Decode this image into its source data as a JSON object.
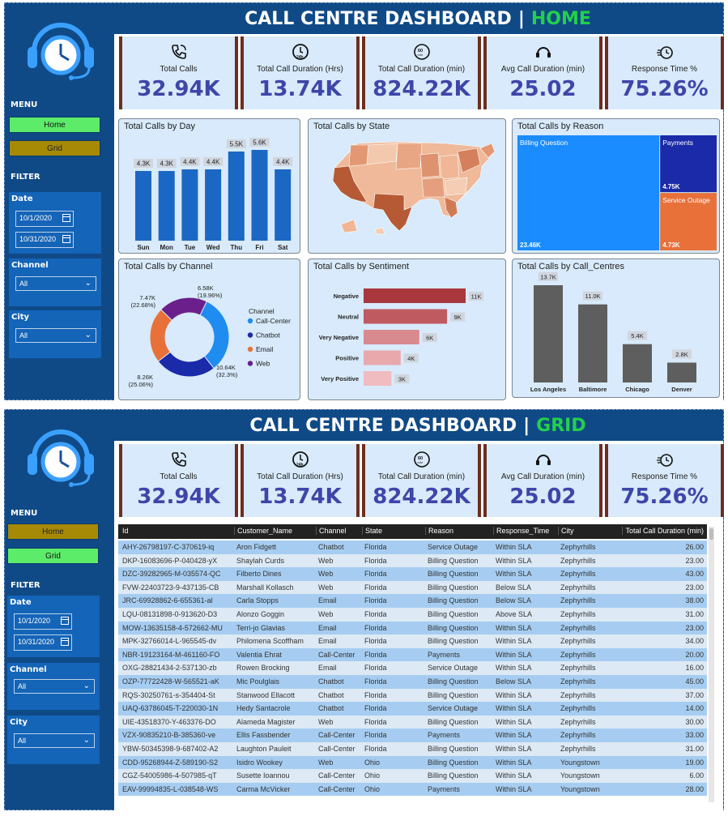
{
  "home": {
    "title": "CALL CENTRE DASHBOARD",
    "separator": "|",
    "section": "HOME",
    "menu_label": "MENU",
    "nav": {
      "home": "Home",
      "grid": "Grid"
    },
    "filter_label": "FILTER",
    "date_label": "Date",
    "date_from": "10/1/2020",
    "date_to": "10/31/2020",
    "channel_label": "Channel",
    "channel_value": "All",
    "city_label": "City",
    "city_value": "All"
  },
  "grid_page": {
    "title": "CALL CENTRE DASHBOARD",
    "separator": "|",
    "section": "GRID",
    "menu_label": "MENU",
    "nav": {
      "home": "Home",
      "grid": "Grid"
    },
    "filter_label": "FILTER",
    "date_label": "Date",
    "date_from": "10/1/2020",
    "date_to": "10/31/2020",
    "channel_label": "Channel",
    "channel_value": "All",
    "city_label": "City",
    "city_value": "All"
  },
  "kpis": [
    {
      "label": "Total Calls",
      "value": "32.94K",
      "icon": "phone-icon"
    },
    {
      "label": "Total Call Duration (Hrs)",
      "value": "13.74K",
      "icon": "24h-clock-icon"
    },
    {
      "label": "Total Call Duration (min)",
      "value": "824.22K",
      "icon": "60min-timer-icon"
    },
    {
      "label": "Avg Call Duration (min)",
      "value": "25.02",
      "icon": "headset-icon"
    },
    {
      "label": "Response Time %",
      "value": "75.26%",
      "icon": "speed-clock-icon"
    }
  ],
  "colors": {
    "header_bg": "#0f4a87",
    "accent_green": "#22d14a",
    "kpi_value": "#3d46a8",
    "bar_blue": "#1b68c4"
  },
  "chart_data": [
    {
      "type": "bar",
      "title": "Total Calls by Day",
      "categories": [
        "Sun",
        "Mon",
        "Tue",
        "Wed",
        "Thu",
        "Fri",
        "Sat"
      ],
      "values": [
        4.3,
        4.3,
        4.4,
        4.4,
        5.5,
        5.6,
        4.4
      ],
      "labels": [
        "4.3K",
        "4.3K",
        "4.4K",
        "4.4K",
        "5.5K",
        "5.6K",
        "4.4K"
      ],
      "unit": "K"
    },
    {
      "type": "map",
      "title": "Total Calls by State"
    },
    {
      "type": "treemap",
      "title": "Total Calls by Reason",
      "items": [
        {
          "name": "Billing Question",
          "value": 23.46,
          "label": "23.46K",
          "color": "#1a8cff"
        },
        {
          "name": "Payments",
          "value": 4.75,
          "label": "4.75K",
          "color": "#1a2aa8"
        },
        {
          "name": "Service Outage",
          "value": 4.73,
          "label": "4.73K",
          "color": "#e8713a"
        }
      ]
    },
    {
      "type": "pie",
      "title": "Total Calls by Channel",
      "legend_title": "Channel",
      "series": [
        {
          "name": "Call-Center",
          "value": 10.64,
          "label": "10.64K",
          "pct": "(32.3%)",
          "color": "#1f8cf0"
        },
        {
          "name": "Chatbot",
          "value": 8.26,
          "label": "8.26K",
          "pct": "(25.06%)",
          "color": "#1a2aa8"
        },
        {
          "name": "Email",
          "value": 7.47,
          "label": "7.47K",
          "pct": "(22.68%)",
          "color": "#e8713a"
        },
        {
          "name": "Web",
          "value": 6.58,
          "label": "6.58K",
          "pct": "(19.96%)",
          "color": "#6a1f8a"
        }
      ]
    },
    {
      "type": "bar",
      "orientation": "horizontal",
      "title": "Total Calls by Sentiment",
      "categories": [
        "Negative",
        "Neutral",
        "Very Negative",
        "Positive",
        "Very Positive"
      ],
      "values": [
        11,
        9,
        6,
        4,
        3
      ],
      "labels": [
        "11K",
        "9K",
        "6K",
        "4K",
        "3K"
      ],
      "colors": [
        "#a8373e",
        "#bf5a60",
        "#d98a8f",
        "#e8a8ac",
        "#f0bcc0"
      ]
    },
    {
      "type": "bar",
      "title": "Total Calls by Call_Centres",
      "categories": [
        "Los Angeles",
        "Baltimore",
        "Chicago",
        "Denver"
      ],
      "values": [
        13.7,
        11.0,
        5.4,
        2.8
      ],
      "labels": [
        "13.7K",
        "11.0K",
        "5.4K",
        "2.8K"
      ],
      "color": "#5e5e5e"
    }
  ],
  "grid": {
    "columns": [
      "Id",
      "Customer_Name",
      "Channel",
      "State",
      "Reason",
      "Response_Time",
      "City",
      "Total Call Duration (min)"
    ],
    "rows": [
      [
        "AHY-26798197-C-370619-iq",
        "Aron Fidgett",
        "Chatbot",
        "Florida",
        "Service Outage",
        "Within SLA",
        "Zephyrhills",
        "26.00"
      ],
      [
        "DKP-16083696-P-040428-yX",
        "Shaylah Curds",
        "Web",
        "Florida",
        "Billing Question",
        "Within SLA",
        "Zephyrhills",
        "23.00"
      ],
      [
        "DZC-39282965-M-035574-QC",
        "Filberto Dines",
        "Web",
        "Florida",
        "Billing Question",
        "Within SLA",
        "Zephyrhills",
        "43.00"
      ],
      [
        "FVW-22403723-9-437135-CB",
        "Marshall Kollasch",
        "Web",
        "Florida",
        "Billing Question",
        "Below SLA",
        "Zephyrhills",
        "23.00"
      ],
      [
        "JRC-69928862-6-655361-al",
        "Carla Stopps",
        "Email",
        "Florida",
        "Billing Question",
        "Below SLA",
        "Zephyrhills",
        "38.00"
      ],
      [
        "LQU-08131898-0-913620-D3",
        "Alonzo Goggin",
        "Web",
        "Florida",
        "Billing Question",
        "Above SLA",
        "Zephyrhills",
        "31.00"
      ],
      [
        "MOW-13635158-4-572662-MU",
        "Terri-jo Glavias",
        "Email",
        "Florida",
        "Billing Question",
        "Within SLA",
        "Zephyrhills",
        "23.00"
      ],
      [
        "MPK-32766014-L-965545-dv",
        "Philomena Scoffham",
        "Email",
        "Florida",
        "Billing Question",
        "Within SLA",
        "Zephyrhills",
        "34.00"
      ],
      [
        "NBR-19123164-M-461160-FO",
        "Valentia Ehrat",
        "Call-Center",
        "Florida",
        "Payments",
        "Within SLA",
        "Zephyrhills",
        "20.00"
      ],
      [
        "OXG-28821434-2-537130-zb",
        "Rowen Brocking",
        "Email",
        "Florida",
        "Service Outage",
        "Within SLA",
        "Zephyrhills",
        "16.00"
      ],
      [
        "OZP-77722428-W-565521-aK",
        "Mic Poulglais",
        "Chatbot",
        "Florida",
        "Billing Question",
        "Below SLA",
        "Zephyrhills",
        "45.00"
      ],
      [
        "RQS-30250761-s-354404-St",
        "Stanwood Ellacott",
        "Chatbot",
        "Florida",
        "Billing Question",
        "Within SLA",
        "Zephyrhills",
        "37.00"
      ],
      [
        "UAQ-63786045-T-220030-1N",
        "Hedy Santacrole",
        "Chatbot",
        "Florida",
        "Service Outage",
        "Within SLA",
        "Zephyrhills",
        "14.00"
      ],
      [
        "UIE-43518370-Y-463376-DO",
        "Alameda Magister",
        "Web",
        "Florida",
        "Billing Question",
        "Within SLA",
        "Zephyrhills",
        "30.00"
      ],
      [
        "VZX-90835210-B-385360-ve",
        "Ellis Fassbender",
        "Call-Center",
        "Florida",
        "Payments",
        "Within SLA",
        "Zephyrhills",
        "33.00"
      ],
      [
        "YBW-50345398-9-687402-A2",
        "Laughton Pauleit",
        "Call-Center",
        "Florida",
        "Billing Question",
        "Within SLA",
        "Zephyrhills",
        "31.00"
      ],
      [
        "CDD-95268944-Z-589190-S2",
        "Isidro Wookey",
        "Web",
        "Ohio",
        "Billing Question",
        "Within SLA",
        "Youngstown",
        "19.00"
      ],
      [
        "CGZ-54005986-4-507985-qT",
        "Susette Ioannou",
        "Call-Center",
        "Ohio",
        "Billing Question",
        "Within SLA",
        "Youngstown",
        "6.00"
      ],
      [
        "EAV-99994835-L-038548-WS",
        "Carma McVicker",
        "Call-Center",
        "Ohio",
        "Payments",
        "Within SLA",
        "Youngstown",
        "28.00"
      ]
    ]
  }
}
